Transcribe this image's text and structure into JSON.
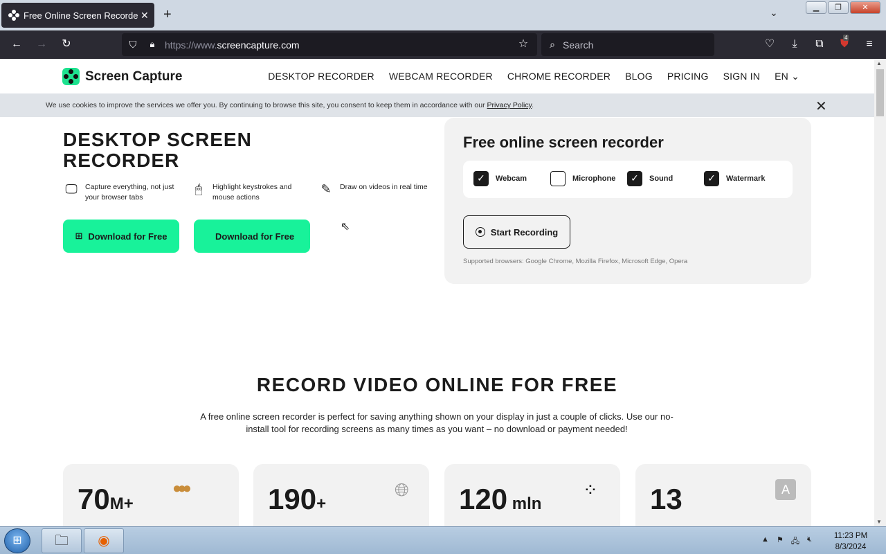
{
  "browser": {
    "tab_title": "Free Online Screen Recorder | O",
    "url_prefix": "https://www.",
    "url_domain": "screencapture.com",
    "search_placeholder": "Search",
    "extension_badge": "4"
  },
  "nav": {
    "brand": "Screen Capture",
    "items": [
      "DESKTOP RECORDER",
      "WEBCAM RECORDER",
      "CHROME RECORDER",
      "BLOG",
      "PRICING",
      "SIGN IN"
    ],
    "lang": "EN"
  },
  "cookie": {
    "text": "We use cookies to improve the services we offer you. By continuing to browse this site, you consent to keep them in accordance with our ",
    "link": "Privacy Policy",
    "suffix": "."
  },
  "hero": {
    "title_line1": "DESKTOP SCREEN",
    "title_line2": "RECORDER",
    "features": [
      {
        "icon": "monitor-icon",
        "text1": "Capture everything, not just",
        "text2": "your browser tabs"
      },
      {
        "icon": "mouse-icon",
        "text1": "Highlight keystrokes and",
        "text2": "mouse actions"
      },
      {
        "icon": "pencil-icon",
        "text1": "Draw on videos in real time",
        "text2": ""
      }
    ],
    "download_windows": "Download for Free",
    "download_mac": "Download for Free"
  },
  "recorder": {
    "title": "Free online screen recorder",
    "options": [
      {
        "label": "Webcam",
        "checked": true
      },
      {
        "label": "Microphone",
        "checked": false
      },
      {
        "label": "Sound",
        "checked": true
      },
      {
        "label": "Watermark",
        "checked": true
      }
    ],
    "start_label": "Start Recording",
    "supported": "Supported browsers: Google Chrome, Mozilla Firefox, Microsoft Edge, Opera"
  },
  "section": {
    "title": "RECORD VIDEO ONLINE FOR FREE",
    "lead_line1": "A free online screen recorder is perfect for saving anything shown on your display in just a couple of clicks. Use our no-",
    "lead_line2": "install tool for recording screens as many times as you want – no download or payment needed!"
  },
  "stats": [
    {
      "value": "70",
      "suffix": "M+",
      "icon": "avatars-icon"
    },
    {
      "value": "190",
      "suffix": "+",
      "icon": "globe-icon"
    },
    {
      "value": "120",
      "suffix": " mln",
      "icon": "dots-logo-icon"
    },
    {
      "value": "13",
      "suffix": "",
      "icon": "translate-icon"
    }
  ],
  "taskbar": {
    "time": "11:23 PM",
    "date": "8/3/2024"
  }
}
